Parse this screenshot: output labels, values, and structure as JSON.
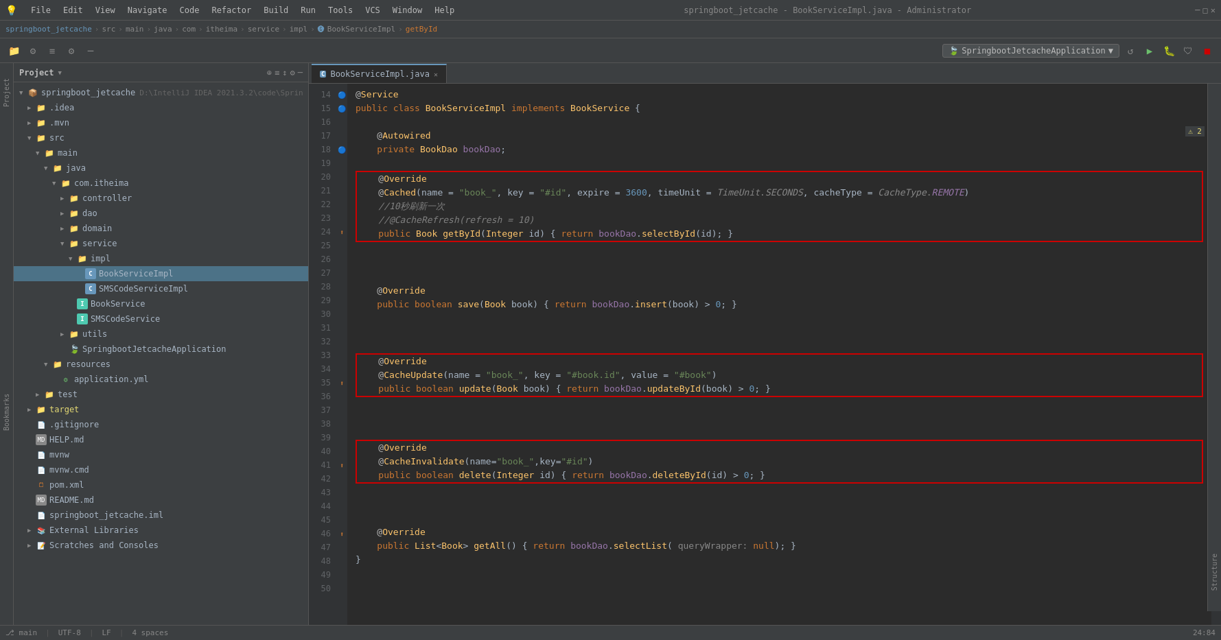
{
  "titlebar": {
    "menus": [
      "File",
      "Edit",
      "View",
      "Navigate",
      "Code",
      "Refactor",
      "Build",
      "Run",
      "Tools",
      "VCS",
      "Window",
      "Help"
    ],
    "title": "springboot_jetcache - BookServiceImpl.java - Administrator",
    "app_icon": "💡"
  },
  "breadcrumb": {
    "parts": [
      "springboot_jetcache",
      "src",
      "main",
      "java",
      "com",
      "itheima",
      "service",
      "impl",
      "BookServiceImpl",
      "getById"
    ]
  },
  "project": {
    "title": "Project",
    "root": "springboot_jetcache",
    "root_path": "D:\\IntelliJ IDEA 2021.3.2\\code\\Sprin"
  },
  "tabs": [
    {
      "label": "BookServiceImpl.java",
      "active": true,
      "icon": "C"
    }
  ],
  "code": {
    "lines": [
      {
        "num": 14,
        "gutter": "",
        "content": "@Service"
      },
      {
        "num": 15,
        "gutter": "g",
        "content": "public class BookServiceImpl implements BookService {"
      },
      {
        "num": 16,
        "gutter": "",
        "content": ""
      },
      {
        "num": 17,
        "gutter": "",
        "content": "    @Autowired"
      },
      {
        "num": 18,
        "gutter": "g",
        "content": "    private BookDao bookDao;"
      },
      {
        "num": 19,
        "gutter": "",
        "content": ""
      },
      {
        "num": 20,
        "gutter": "",
        "content": "    @Override",
        "boxStart": true
      },
      {
        "num": 21,
        "gutter": "",
        "content": "    @Cached(name = \"book_\", key = \"#id\", expire = 3600, timeUnit = TimeUnit.SECONDS, cacheType = CacheType.REMOTE)"
      },
      {
        "num": 22,
        "gutter": "",
        "content": "    //10秒刷新一次"
      },
      {
        "num": 23,
        "gutter": "",
        "content": "    //@CacheRefresh(refresh = 10)"
      },
      {
        "num": 24,
        "gutter": "a",
        "content": "    public Book getById(Integer id) { return bookDao.selectById(id); }",
        "boxEnd": true
      },
      {
        "num": 25,
        "gutter": "",
        "content": ""
      },
      {
        "num": 26,
        "gutter": "",
        "content": ""
      },
      {
        "num": 27,
        "gutter": "",
        "content": ""
      },
      {
        "num": 28,
        "gutter": "",
        "content": "    @Override"
      },
      {
        "num": 29,
        "gutter": "",
        "content": "    public boolean save(Book book) { return bookDao.insert(book) > 0; }"
      },
      {
        "num": 30,
        "gutter": "",
        "content": ""
      },
      {
        "num": 31,
        "gutter": "",
        "content": ""
      },
      {
        "num": 32,
        "gutter": "",
        "content": ""
      },
      {
        "num": 33,
        "gutter": "",
        "content": "    @Override",
        "boxStart": true
      },
      {
        "num": 34,
        "gutter": "",
        "content": "    @CacheUpdate(name = \"book_\", key = \"#book.id\", value = \"#book\")"
      },
      {
        "num": 35,
        "gutter": "a",
        "content": "    public boolean update(Book book) { return bookDao.updateById(book) > 0; }",
        "boxEnd": true
      },
      {
        "num": 36,
        "gutter": "",
        "content": ""
      },
      {
        "num": 37,
        "gutter": "",
        "content": ""
      },
      {
        "num": 38,
        "gutter": "",
        "content": ""
      },
      {
        "num": 39,
        "gutter": "",
        "content": "    @Override",
        "boxStart": true
      },
      {
        "num": 40,
        "gutter": "",
        "content": "    @CacheInvalidate(name=\"book_\",key=\"#id\")"
      },
      {
        "num": 41,
        "gutter": "a",
        "content": "    public boolean delete(Integer id) { return bookDao.deleteById(id) > 0; }",
        "boxEnd": true
      },
      {
        "num": 42,
        "gutter": "",
        "content": ""
      },
      {
        "num": 43,
        "gutter": "",
        "content": ""
      },
      {
        "num": 44,
        "gutter": "",
        "content": ""
      },
      {
        "num": 45,
        "gutter": "",
        "content": "    @Override"
      },
      {
        "num": 46,
        "gutter": "a",
        "content": "    public List<Book> getAll() { return bookDao.selectList( queryWrapper: null); }"
      },
      {
        "num": 47,
        "gutter": "",
        "content": "}"
      },
      {
        "num": 48,
        "gutter": "",
        "content": ""
      },
      {
        "num": 49,
        "gutter": "",
        "content": ""
      },
      {
        "num": 50,
        "gutter": "",
        "content": ""
      }
    ]
  },
  "tree": {
    "items": [
      {
        "id": "root",
        "label": "springboot_jetcache",
        "sub": "D:\\IntelliJ IDEA 2021.3.2\\code\\Sprin",
        "indent": 8,
        "type": "project",
        "expanded": true,
        "arrow": "▼"
      },
      {
        "id": "idea",
        "label": ".idea",
        "indent": 20,
        "type": "folder",
        "expanded": false,
        "arrow": "▶"
      },
      {
        "id": "mvn",
        "label": ".mvn",
        "indent": 20,
        "type": "folder",
        "expanded": false,
        "arrow": "▶"
      },
      {
        "id": "src",
        "label": "src",
        "indent": 20,
        "type": "folder",
        "expanded": true,
        "arrow": "▼"
      },
      {
        "id": "main",
        "label": "main",
        "indent": 32,
        "type": "folder",
        "expanded": true,
        "arrow": "▼"
      },
      {
        "id": "java",
        "label": "java",
        "indent": 44,
        "type": "folder",
        "expanded": true,
        "arrow": "▼"
      },
      {
        "id": "com",
        "label": "com.itheima",
        "indent": 56,
        "type": "package",
        "expanded": true,
        "arrow": "▼"
      },
      {
        "id": "controller",
        "label": "controller",
        "indent": 68,
        "type": "folder",
        "expanded": false,
        "arrow": "▶"
      },
      {
        "id": "dao",
        "label": "dao",
        "indent": 68,
        "type": "folder",
        "expanded": false,
        "arrow": "▶"
      },
      {
        "id": "domain",
        "label": "domain",
        "indent": 68,
        "type": "folder",
        "expanded": false,
        "arrow": "▶"
      },
      {
        "id": "service",
        "label": "service",
        "indent": 68,
        "type": "folder",
        "expanded": true,
        "arrow": "▼"
      },
      {
        "id": "impl",
        "label": "impl",
        "indent": 80,
        "type": "folder",
        "expanded": true,
        "arrow": "▼"
      },
      {
        "id": "BookServiceImpl",
        "label": "BookServiceImpl",
        "indent": 92,
        "type": "class",
        "selected": true
      },
      {
        "id": "SMSCodeServiceImpl",
        "label": "SMSCodeServiceImpl",
        "indent": 92,
        "type": "class"
      },
      {
        "id": "BookService",
        "label": "BookService",
        "indent": 80,
        "type": "interface"
      },
      {
        "id": "SMSCodeService",
        "label": "SMSCodeService",
        "indent": 80,
        "type": "interface"
      },
      {
        "id": "utils",
        "label": "utils",
        "indent": 68,
        "type": "folder",
        "expanded": false,
        "arrow": "▶"
      },
      {
        "id": "SpringbootJetcacheApp",
        "label": "SpringbootJetcacheApplication",
        "indent": 68,
        "type": "spring"
      },
      {
        "id": "resources",
        "label": "resources",
        "indent": 44,
        "type": "folder",
        "expanded": true,
        "arrow": "▼"
      },
      {
        "id": "appyml",
        "label": "application.yml",
        "indent": 56,
        "type": "yml"
      },
      {
        "id": "test",
        "label": "test",
        "indent": 32,
        "type": "folder",
        "expanded": false,
        "arrow": "▶"
      },
      {
        "id": "target",
        "label": "target",
        "indent": 20,
        "type": "folder-yellow",
        "expanded": false,
        "arrow": "▶"
      },
      {
        "id": "gitignore",
        "label": ".gitignore",
        "indent": 20,
        "type": "git"
      },
      {
        "id": "HELP",
        "label": "HELP.md",
        "indent": 20,
        "type": "md"
      },
      {
        "id": "mvnw",
        "label": "mvnw",
        "indent": 20,
        "type": "file"
      },
      {
        "id": "mvnwcmd",
        "label": "mvnw.cmd",
        "indent": 20,
        "type": "file"
      },
      {
        "id": "pom",
        "label": "pom.xml",
        "indent": 20,
        "type": "xml"
      },
      {
        "id": "README",
        "label": "README.md",
        "indent": 20,
        "type": "md"
      },
      {
        "id": "springboot_jetcache_iml",
        "label": "springboot_jetcache.iml",
        "indent": 20,
        "type": "iml"
      },
      {
        "id": "extlibs",
        "label": "External Libraries",
        "indent": 20,
        "type": "extlib",
        "arrow": "▶"
      },
      {
        "id": "scratches",
        "label": "Scratches and Consoles",
        "indent": 20,
        "type": "scratches",
        "arrow": "▶"
      }
    ]
  },
  "sidebar_left": {
    "labels": [
      "Project",
      "Bookmarks",
      "Structure"
    ]
  },
  "sidebar_right": {
    "labels": [
      "Structure",
      "Bookmarks"
    ]
  },
  "status_bar": {
    "line_col": "24:84",
    "encoding": "UTF-8",
    "lf": "LF",
    "indent": "4 spaces",
    "git": "main"
  },
  "warning": "⚠ 2"
}
